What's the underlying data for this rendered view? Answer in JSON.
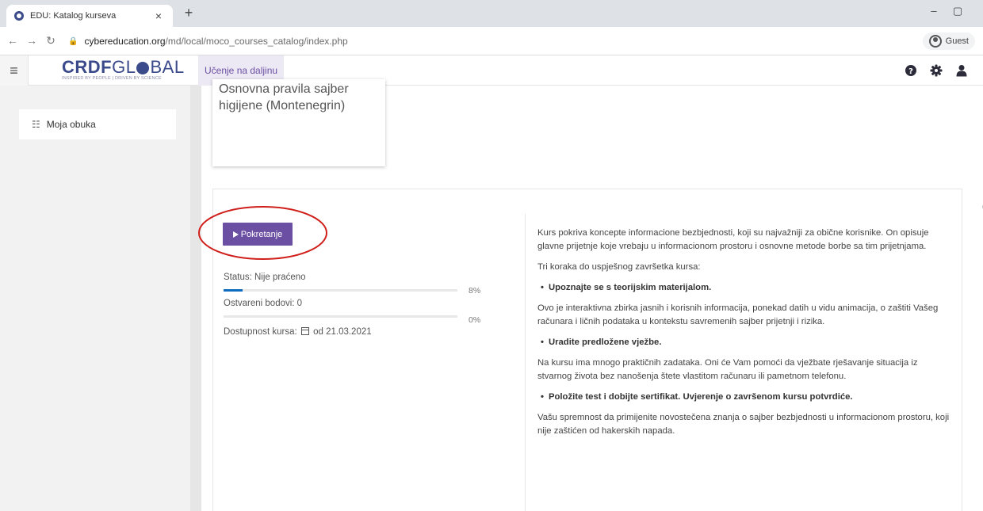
{
  "browser": {
    "tab_title": "EDU: Katalog kurseva",
    "tab_close": "×",
    "new_tab": "+",
    "url_host": "cybereducation.org",
    "url_path": "/md/local/moco_courses_catalog/index.php",
    "guest_label": "Guest",
    "minimize": "–",
    "maximize": "▢"
  },
  "header": {
    "logo_bold": "CRDF",
    "logo_light": "GL",
    "logo_end": "BAL",
    "logo_tagline": "INSPIRED BY PEOPLE | DRIVEN BY SCIENCE",
    "nav_link": "Učenje na daljinu",
    "colors": {
      "brand": "#3a4a8a",
      "accent": "#6b4fa2"
    }
  },
  "sidebar": {
    "items": [
      {
        "label": "Moja obuka",
        "icon": "enroll-icon"
      }
    ]
  },
  "course": {
    "title": "Osnovna pravila sajber higijene (Montenegrin)"
  },
  "details": {
    "launch_label": "Pokretanje",
    "status_label": "Status: Nije praćeno",
    "status_progress": 8,
    "status_pct_text": "8%",
    "points_label": "Ostvareni bodovi: 0",
    "points_progress": 0,
    "points_pct_text": "0%",
    "availability_prefix": "Dostupnost kursa:",
    "availability_date": "od 21.03.2021",
    "description": {
      "intro": "Kurs pokriva koncepte informacione bezbjednosti, koji su najvažniji za obične korisnike. On opisuje glavne prijetnje koje vrebaju u informacionom prostoru i osnovne metode borbe sa tim prijetnjama.",
      "steps_heading": "Tri koraka do uspješnog završetka kursa:",
      "step1_title": "Upoznajte se s teorijskim materijalom.",
      "step1_text": "Ovo je interaktivna zbirka jasnih i korisnih informacija, ponekad datih u vidu animacija, o zaštiti Vašeg računara i ličnih podataka u kontekstu savremenih sajber prijetnji i rizika.",
      "step2_title": "Uradite predložene vježbe.",
      "step2_text": "Na kursu ima mnogo praktičnih zadataka. Oni će Vam pomoći da vježbate rješavanje situacija iz stvarnog života bez nanošenja štete vlastitom računaru ili pametnom telefonu.",
      "step3_title": "Položite test i dobijte sertifikat. Uvjerenje o završenom kursu potvrdiće.",
      "step3_text": "Vašu spremnost da primijenite novostečena znanja o sajber bezbjednosti u informacionom prostoru, koji nije zaštićen od hakerskih napada."
    }
  }
}
